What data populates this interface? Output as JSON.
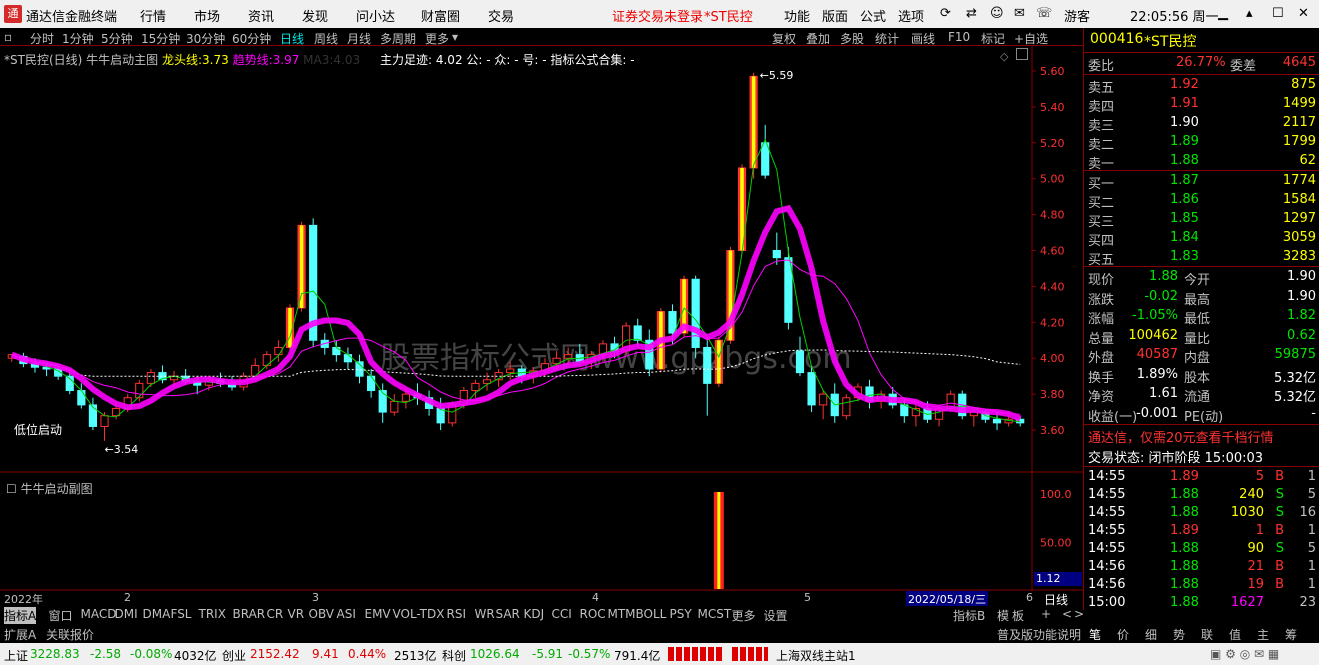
{
  "menu": {
    "logo": "通",
    "app_name": "通达信金融终端",
    "items": [
      "行情",
      "市场",
      "资讯",
      "发现",
      "问小达",
      "财富圈",
      "交易"
    ],
    "login_notice": "证券交易未登录",
    "stock_label": "*ST民控",
    "right_items": [
      "功能",
      "版面",
      "公式",
      "选项"
    ],
    "user": "游客",
    "time": "22:05:56 周一"
  },
  "periods": [
    "分时",
    "1分钟",
    "5分钟",
    "15分钟",
    "30分钟",
    "60分钟",
    "日线",
    "周线",
    "月线",
    "多周期",
    "更多"
  ],
  "tools": [
    "复权",
    "叠加",
    "多股",
    "统计",
    "画线",
    "F10",
    "标记",
    "+自选"
  ],
  "chart": {
    "header": {
      "name": "*ST民控(日线)",
      "indicator": "牛牛启动主图",
      "dragon_label": "龙头线:",
      "dragon_value": "3.73",
      "trend_label": "趋势线:",
      "trend_value": "3.97",
      "ma_label": "MA3:",
      "ma_value": "4.03",
      "info": "主力足迹: 4.02 公: - 众: - 号: - 指标公式合集: -"
    },
    "ylabels": [
      "5.60",
      "5.40",
      "5.20",
      "5.00",
      "4.80",
      "4.60",
      "4.40",
      "4.20",
      "4.00",
      "3.80",
      "3.60"
    ],
    "high_label": "5.59",
    "low_label": "3.54",
    "signal_label": "低位启动",
    "watermark": "股票指标公式网www.gpzbgs.com",
    "sub_title": "牛牛启动副图",
    "sub_ylabels": [
      "100.0",
      "50.00"
    ],
    "sub_value": "1.12",
    "dates": [
      "2022年",
      "2",
      "3",
      "4",
      "5",
      "6"
    ],
    "cursor_date": "2022/05/18/三",
    "period_tag": "日线"
  },
  "chart_data": {
    "type": "candlestick",
    "ylim": [
      3.5,
      5.65
    ],
    "candles": [
      [
        4.0,
        4.02,
        3.98,
        4.02
      ],
      [
        4.01,
        4.03,
        3.95,
        3.97
      ],
      [
        3.97,
        4.0,
        3.92,
        3.95
      ],
      [
        3.95,
        3.98,
        3.9,
        3.94
      ],
      [
        3.94,
        3.96,
        3.88,
        3.9
      ],
      [
        3.9,
        3.93,
        3.8,
        3.82
      ],
      [
        3.82,
        3.86,
        3.72,
        3.74
      ],
      [
        3.74,
        3.78,
        3.6,
        3.62
      ],
      [
        3.62,
        3.7,
        3.54,
        3.68
      ],
      [
        3.68,
        3.75,
        3.66,
        3.72
      ],
      [
        3.72,
        3.8,
        3.7,
        3.78
      ],
      [
        3.78,
        3.88,
        3.76,
        3.86
      ],
      [
        3.86,
        3.94,
        3.84,
        3.92
      ],
      [
        3.92,
        3.96,
        3.86,
        3.88
      ],
      [
        3.88,
        3.93,
        3.84,
        3.9
      ],
      [
        3.9,
        3.94,
        3.85,
        3.87
      ],
      [
        3.87,
        3.9,
        3.8,
        3.85
      ],
      [
        3.85,
        3.9,
        3.82,
        3.88
      ],
      [
        3.88,
        3.92,
        3.84,
        3.86
      ],
      [
        3.86,
        3.9,
        3.82,
        3.84
      ],
      [
        3.84,
        3.92,
        3.82,
        3.9
      ],
      [
        3.9,
        4.0,
        3.88,
        3.96
      ],
      [
        3.96,
        4.04,
        3.94,
        4.02
      ],
      [
        4.02,
        4.1,
        3.98,
        4.06
      ],
      [
        4.06,
        4.3,
        4.04,
        4.28
      ],
      [
        4.28,
        4.76,
        4.26,
        4.74
      ],
      [
        4.74,
        4.78,
        4.06,
        4.1
      ],
      [
        4.1,
        4.14,
        4.02,
        4.06
      ],
      [
        4.06,
        4.1,
        3.98,
        4.02
      ],
      [
        4.02,
        4.06,
        3.94,
        3.98
      ],
      [
        3.98,
        4.02,
        3.86,
        3.9
      ],
      [
        3.9,
        3.94,
        3.78,
        3.82
      ],
      [
        3.82,
        3.86,
        3.64,
        3.7
      ],
      [
        3.7,
        3.8,
        3.68,
        3.76
      ],
      [
        3.76,
        3.84,
        3.72,
        3.8
      ],
      [
        3.8,
        3.86,
        3.74,
        3.78
      ],
      [
        3.78,
        3.82,
        3.68,
        3.72
      ],
      [
        3.72,
        3.78,
        3.6,
        3.64
      ],
      [
        3.64,
        3.76,
        3.62,
        3.74
      ],
      [
        3.74,
        3.84,
        3.72,
        3.82
      ],
      [
        3.82,
        3.88,
        3.78,
        3.86
      ],
      [
        3.86,
        3.92,
        3.82,
        3.88
      ],
      [
        3.88,
        3.94,
        3.84,
        3.92
      ],
      [
        3.92,
        3.98,
        3.88,
        3.94
      ],
      [
        3.94,
        3.96,
        3.86,
        3.9
      ],
      [
        3.9,
        3.95,
        3.86,
        3.93
      ],
      [
        3.93,
        4.0,
        3.9,
        3.97
      ],
      [
        3.97,
        4.04,
        3.94,
        4.0
      ],
      [
        4.0,
        4.06,
        3.96,
        4.02
      ],
      [
        4.02,
        4.08,
        3.96,
        3.98
      ],
      [
        3.98,
        4.04,
        3.94,
        4.02
      ],
      [
        4.02,
        4.1,
        3.98,
        4.08
      ],
      [
        4.08,
        4.12,
        4.0,
        4.04
      ],
      [
        4.04,
        4.2,
        4.02,
        4.18
      ],
      [
        4.18,
        4.22,
        4.06,
        4.1
      ],
      [
        4.1,
        4.16,
        3.9,
        3.94
      ],
      [
        3.94,
        4.28,
        3.92,
        4.26
      ],
      [
        4.26,
        4.3,
        4.08,
        4.14
      ],
      [
        4.14,
        4.46,
        4.12,
        4.44
      ],
      [
        4.44,
        4.46,
        4.0,
        4.06
      ],
      [
        4.06,
        4.12,
        3.68,
        3.86
      ],
      [
        3.86,
        4.12,
        3.84,
        4.1
      ],
      [
        4.1,
        4.62,
        4.08,
        4.6
      ],
      [
        4.6,
        5.08,
        4.58,
        5.06
      ],
      [
        5.06,
        5.59,
        5.0,
        5.57
      ],
      [
        5.2,
        5.3,
        5.0,
        5.02
      ],
      [
        4.6,
        4.7,
        4.52,
        4.56
      ],
      [
        4.56,
        4.62,
        4.16,
        4.2
      ],
      [
        4.04,
        4.12,
        3.9,
        3.92
      ],
      [
        3.92,
        3.96,
        3.7,
        3.74
      ],
      [
        3.74,
        3.82,
        3.66,
        3.8
      ],
      [
        3.8,
        3.86,
        3.64,
        3.68
      ],
      [
        3.68,
        3.8,
        3.66,
        3.78
      ],
      [
        3.78,
        3.86,
        3.76,
        3.84
      ],
      [
        3.84,
        3.88,
        3.72,
        3.76
      ],
      [
        3.76,
        3.82,
        3.72,
        3.8
      ],
      [
        3.8,
        3.84,
        3.72,
        3.74
      ],
      [
        3.74,
        3.78,
        3.64,
        3.68
      ],
      [
        3.68,
        3.74,
        3.62,
        3.72
      ],
      [
        3.72,
        3.76,
        3.64,
        3.66
      ],
      [
        3.66,
        3.74,
        3.62,
        3.72
      ],
      [
        3.72,
        3.82,
        3.7,
        3.8
      ],
      [
        3.8,
        3.82,
        3.66,
        3.68
      ],
      [
        3.68,
        3.72,
        3.62,
        3.7
      ],
      [
        3.7,
        3.72,
        3.64,
        3.66
      ],
      [
        3.66,
        3.7,
        3.6,
        3.64
      ],
      [
        3.64,
        3.68,
        3.62,
        3.66
      ],
      [
        3.66,
        3.68,
        3.62,
        3.64
      ]
    ],
    "signals": [
      {
        "index": 61,
        "value": 100
      }
    ]
  },
  "quote": {
    "code": "000416",
    "name": "*ST民控",
    "wb_label": "委比",
    "wb_value": "26.77%",
    "wc_label": "委差",
    "wc_value": "4645",
    "asks": [
      {
        "label": "卖五",
        "price": "1.92",
        "vol": "875"
      },
      {
        "label": "卖四",
        "price": "1.91",
        "vol": "1499"
      },
      {
        "label": "卖三",
        "price": "1.90",
        "vol": "2117"
      },
      {
        "label": "卖二",
        "price": "1.89",
        "vol": "1799"
      },
      {
        "label": "卖一",
        "price": "1.88",
        "vol": "62"
      }
    ],
    "bids": [
      {
        "label": "买一",
        "price": "1.87",
        "vol": "1774"
      },
      {
        "label": "买二",
        "price": "1.86",
        "vol": "1584"
      },
      {
        "label": "买三",
        "price": "1.85",
        "vol": "1297"
      },
      {
        "label": "买四",
        "price": "1.84",
        "vol": "3059"
      },
      {
        "label": "买五",
        "price": "1.83",
        "vol": "3283"
      }
    ],
    "stats": [
      {
        "l1": "现价",
        "v1": "1.88",
        "l2": "今开",
        "v2": "1.90"
      },
      {
        "l1": "涨跌",
        "v1": "-0.02",
        "l2": "最高",
        "v2": "1.90"
      },
      {
        "l1": "涨幅",
        "v1": "-1.05%",
        "l2": "最低",
        "v2": "1.82"
      },
      {
        "l1": "总量",
        "v1": "100462",
        "l2": "量比",
        "v2": "0.62"
      },
      {
        "l1": "外盘",
        "v1": "40587",
        "l2": "内盘",
        "v2": "59875"
      },
      {
        "l1": "换手",
        "v1": "1.89%",
        "l2": "股本",
        "v2": "5.32亿"
      },
      {
        "l1": "净资",
        "v1": "1.61",
        "l2": "流通",
        "v2": "5.32亿"
      },
      {
        "l1": "收益(一)",
        "v1": "-0.001",
        "l2": "PE(动)",
        "v2": "-"
      }
    ],
    "promo": "通达信，仅需20元查看千档行情",
    "trade_state": "交易状态: 闭市阶段 15:00:03",
    "ticks": [
      {
        "t": "14:55",
        "p": "1.89",
        "v": "5",
        "bs": "B",
        "n": "1"
      },
      {
        "t": "14:55",
        "p": "1.88",
        "v": "240",
        "bs": "S",
        "n": "5"
      },
      {
        "t": "14:55",
        "p": "1.88",
        "v": "1030",
        "bs": "S",
        "n": "16"
      },
      {
        "t": "14:55",
        "p": "1.89",
        "v": "1",
        "bs": "B",
        "n": "1"
      },
      {
        "t": "14:55",
        "p": "1.88",
        "v": "90",
        "bs": "S",
        "n": "5"
      },
      {
        "t": "14:56",
        "p": "1.88",
        "v": "21",
        "bs": "B",
        "n": "1"
      },
      {
        "t": "14:56",
        "p": "1.88",
        "v": "19",
        "bs": "B",
        "n": "1"
      },
      {
        "t": "15:00",
        "p": "1.88",
        "v": "1627",
        "bs": "",
        "n": "23"
      }
    ]
  },
  "bottom_tabs": [
    "指标A",
    "窗口",
    "MACD",
    "DMI",
    "DMA",
    "FSL",
    "TRIX",
    "BRAR",
    "CR",
    "VR",
    "OBV",
    "ASI",
    "EMV",
    "VOL-TDX",
    "RSI",
    "WR",
    "SAR",
    "KDJ",
    "CCI",
    "ROC",
    "MTM",
    "BOLL",
    "PSY",
    "MCST",
    "更多",
    "设置"
  ],
  "bottom_right_tabs": [
    "指标B",
    "模",
    "板",
    "+",
    "<",
    ">"
  ],
  "bottom_tabs2": [
    "扩展A",
    "关联报价"
  ],
  "right_tabs": [
    "普及版功能说明",
    "笔",
    "价",
    "细",
    "势",
    "联",
    "值",
    "主",
    "筹"
  ],
  "status": {
    "sh_label": "上证",
    "sh_val": "3228.83",
    "sh_chg": "-2.58",
    "sh_pct": "-0.08%",
    "sh_amt": "4032亿",
    "cy_label": "创业",
    "cy_val": "2152.42",
    "cy_chg": "9.41",
    "cy_pct": "0.44%",
    "cy_amt": "2513亿",
    "kc_label": "科创",
    "kc_val": "1026.64",
    "kc_chg": "-5.91",
    "kc_pct": "-0.57%",
    "kc_amt": "791.4亿",
    "server": "上海双线主站1"
  }
}
